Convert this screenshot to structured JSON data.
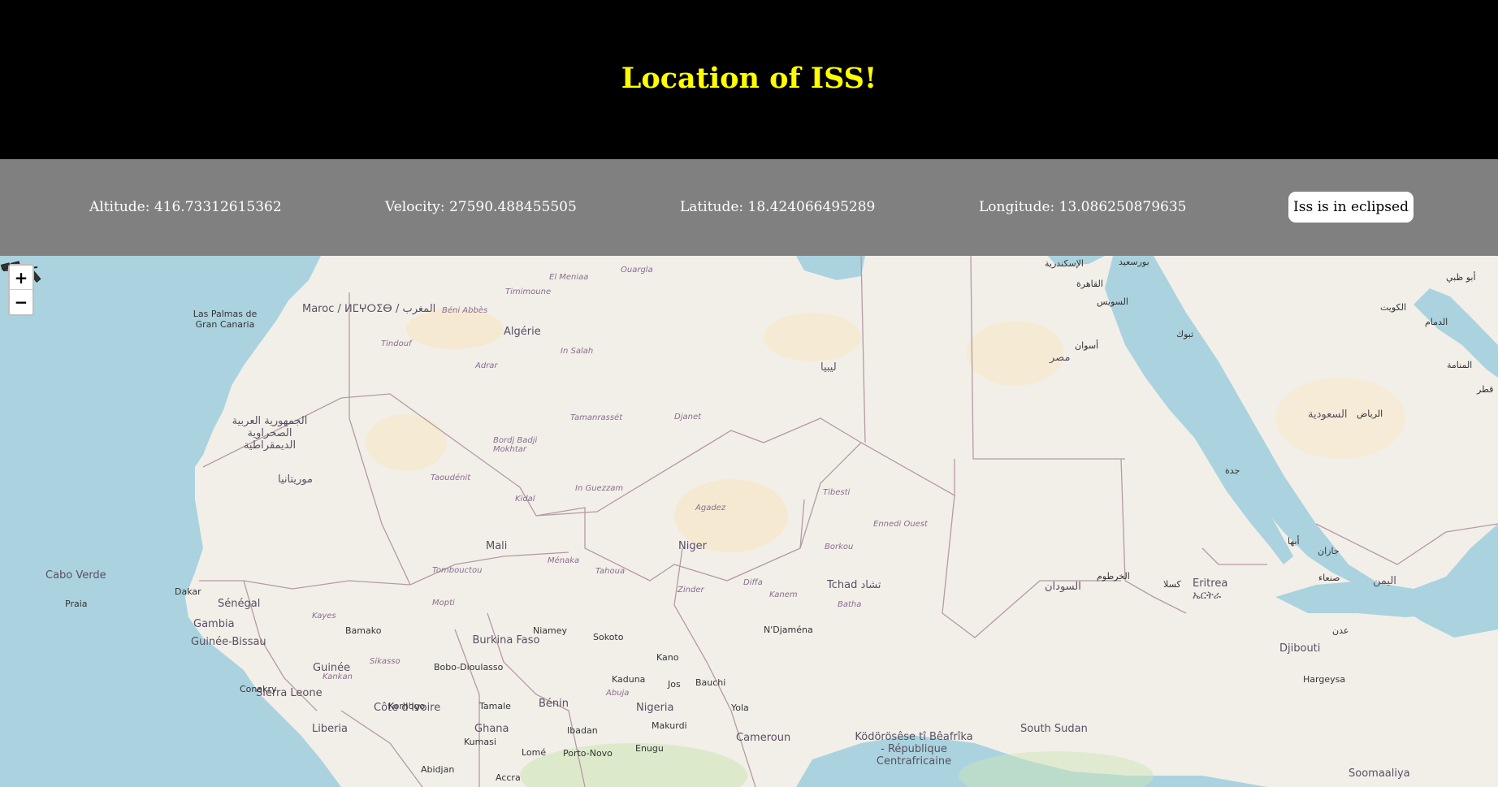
{
  "header": {
    "title": "Location of ISS!"
  },
  "stats": {
    "altitude": "Altitude: 416.73312615362",
    "velocity": "Velocity: 27590.488455505",
    "latitude": "Latitude: 18.424066495289",
    "longitude": "Longitude: 13.086250879635",
    "eclipse_status": "Iss is in eclipsed"
  },
  "map_controls": {
    "zoom_in": "+",
    "zoom_out": "−"
  },
  "map_labels": {
    "countries": [
      "Maroc / ⵍⵎⵖⵔⵉⴱ / المغرب",
      "Algérie",
      "Mali",
      "Niger",
      "Tchad تشاد",
      "Sénégal",
      "Gambia",
      "Guinée-Bissau",
      "Guinée",
      "Sierra Leone",
      "Liberia",
      "Côte d'Ivoire",
      "Burkina Faso",
      "Ghana",
      "Bénin",
      "Nigeria",
      "Cameroun",
      "السودان",
      "South Sudan",
      "مصر",
      "ليبيا",
      "Eritrea ኤርትራ",
      "Djibouti",
      "Cabo Verde",
      "موريتانيا",
      "الجمهورية العربية الصحراوية الديمقراطية",
      "اليمن",
      "السعودية",
      "Ködörösêse tî Bêafrîka - République Centrafricaine",
      "Soomaaliya"
    ],
    "cities": [
      "Las Palmas de Gran Canaria",
      "Praia",
      "Dakar",
      "Bamako",
      "Niamey",
      "Sokoto",
      "Kano",
      "Kaduna",
      "Jos",
      "Bauchi",
      "Yola",
      "Abuja",
      "Ibadan",
      "Lomé",
      "Accra",
      "Abidjan",
      "Porto-Novo",
      "Conakry",
      "Korhogo",
      "Bobo-Dioulasso",
      "Tamale",
      "Kumasi",
      "Makurdi",
      "Enugu",
      "N'Djaména",
      "Agadez",
      "Tamanrassét",
      "Djanet",
      "In Salah",
      "Adrar",
      "Béni Abbès",
      "Timimoune",
      "El Meniaa",
      "Ouargla",
      "Tindouf",
      "Kidal",
      "Taoudénit",
      "Ménaka",
      "Tahoua",
      "Zinder",
      "Diffa",
      "Tombouctou",
      "Mopti",
      "Kayes",
      "Kankan",
      "Sikasso",
      "Bordj Badji Mokhtar",
      "In Guezzam",
      "Tibesti",
      "Ennedi Ouest",
      "Borkou",
      "Kanem",
      "Batha",
      "Hargeysa",
      "الرياض",
      "تبوك",
      "أسوان",
      "الخرطوم",
      "كسلا",
      "جدة",
      "أبها",
      "جازان",
      "صنعاء",
      "عدن",
      "الدمام",
      "المنامة",
      "الكويت",
      "قطر",
      "أبو ظبي",
      "السويس",
      "القاهرة",
      "الإسكندرية",
      "بورسعيد"
    ]
  }
}
